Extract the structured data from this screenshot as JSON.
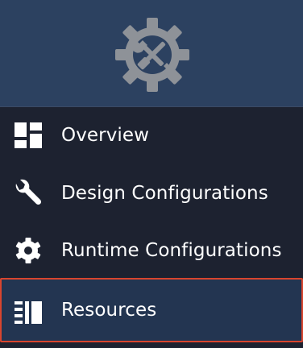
{
  "header": {
    "logo_icon": "gear-with-tools-icon"
  },
  "nav": {
    "items": [
      {
        "label": "Overview",
        "icon": "dashboard-grid-icon"
      },
      {
        "label": "Design Configurations",
        "icon": "wrench-icon"
      },
      {
        "label": "Runtime Configurations",
        "icon": "gear-icon"
      },
      {
        "label": "Resources",
        "icon": "list-columns-icon",
        "selected": true
      }
    ]
  },
  "colors": {
    "sidebar_bg": "#1d2230",
    "header_bg": "#2c4160",
    "selected_bg": "#233551",
    "selected_border": "#d9452e",
    "logo_gray": "#8e9298",
    "text": "#ffffff"
  }
}
